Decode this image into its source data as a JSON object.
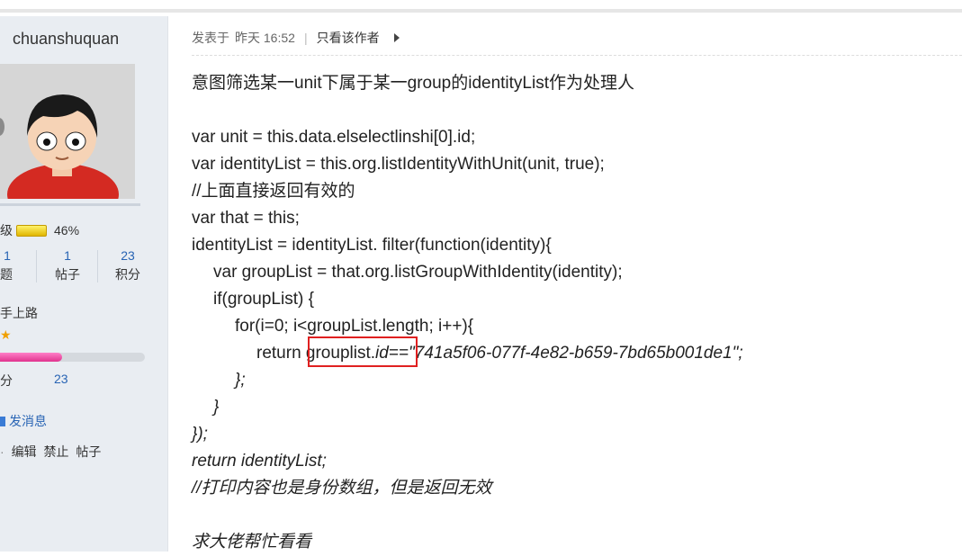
{
  "sidebar": {
    "username": "chuanshuquan",
    "level_label": "级",
    "level_percent_text": "46%",
    "level_progress": 0.46,
    "stats": [
      {
        "value": "1",
        "label": "主题"
      },
      {
        "value": "1",
        "label": "帖子"
      },
      {
        "value": "23",
        "label": "积分"
      }
    ],
    "rank_title": "手上路",
    "star_glyph": "★",
    "credit_progress": 0.46,
    "points_label": "分",
    "points_value": "23",
    "send_message": "发消息",
    "admin_links": [
      "编辑",
      "禁止",
      "帖子"
    ]
  },
  "post": {
    "posted_label": "发表于",
    "posted_time": "昨天 16:52",
    "separator": "|",
    "author_only": "只看该作者",
    "lines": [
      {
        "text": "意图筛选某一unit下属于某一group的identityList作为处理人",
        "italic": false,
        "indent": 0
      },
      {
        "text": "",
        "italic": false,
        "indent": 0
      },
      {
        "text": "var unit = this.data.elselectlinshi[0].id;",
        "italic": false,
        "indent": 0
      },
      {
        "text": "var identityList = this.org.listIdentityWithUnit(unit, true);",
        "italic": false,
        "indent": 0
      },
      {
        "text": "//上面直接返回有效的",
        "italic": false,
        "indent": 0
      },
      {
        "text": "var that = this;",
        "italic": false,
        "indent": 0
      },
      {
        "text": "identityList = identityList. filter(function(identity){",
        "italic": false,
        "indent": 0
      },
      {
        "text": "var groupList = that.org.listGroupWithIdentity(identity);",
        "italic": false,
        "indent": 1
      },
      {
        "text": "if(groupList) {",
        "italic": false,
        "indent": 1
      },
      {
        "text": "for(i=0; i<groupList.length; i++){",
        "italic": false,
        "indent": 2
      },
      {
        "text_normal": "return grouplist.",
        "text_italic": "id==\"741a5f06-077f-4e82-b659-7bd65b001de1\";",
        "indent": 3
      },
      {
        "text": "};",
        "italic": true,
        "indent": 2
      },
      {
        "text": "}",
        "italic": true,
        "indent": 1
      },
      {
        "text": "});",
        "italic": true,
        "indent": 0
      },
      {
        "text": "return identityList;",
        "italic": true,
        "indent": 0
      },
      {
        "text": "//打印内容也是身份数组，但是返回无效",
        "italic": true,
        "indent": 0
      },
      {
        "text": "",
        "italic": false,
        "indent": 0
      },
      {
        "text": "求大佬帮忙看看",
        "italic": true,
        "indent": 0
      }
    ]
  },
  "colors": {
    "link": "#2864b4",
    "highlight_box": "#e02020",
    "sidebar_bg": "#e9edf2"
  }
}
